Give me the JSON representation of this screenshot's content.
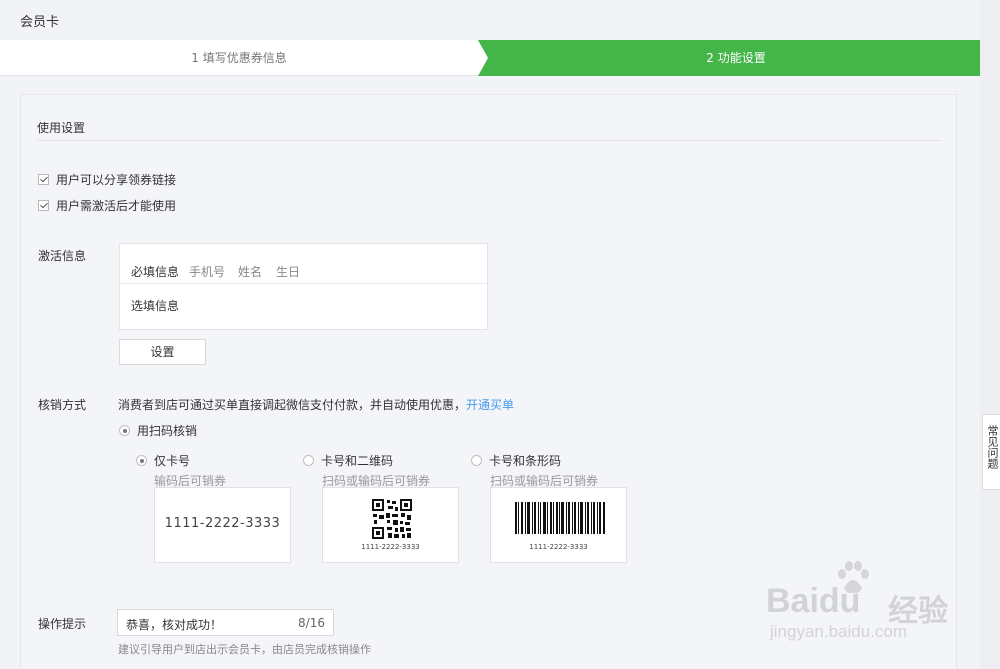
{
  "header": {
    "title": "会员卡"
  },
  "steps": [
    {
      "label": "1 填写优惠券信息",
      "active": false
    },
    {
      "label": "2 功能设置",
      "active": true
    }
  ],
  "colors": {
    "accent": "#44b549",
    "link": "#459ae9"
  },
  "section": {
    "title": "使用设置"
  },
  "checkboxes": [
    {
      "label": "用户可以分享领券链接",
      "checked": true
    },
    {
      "label": "用户需激活后才能使用",
      "checked": true
    }
  ],
  "activation": {
    "label": "激活信息",
    "required_label": "必填信息",
    "required_items": [
      "手机号",
      "姓名",
      "生日"
    ],
    "optional_label": "选填信息",
    "setting_button": "设置"
  },
  "verify": {
    "label": "核销方式",
    "description": "消费者到店可通过买单直接调起微信支付付款，并自动使用优惠，",
    "link": "开通买单",
    "scan_option": "用扫码核销",
    "options": [
      {
        "label": "仅卡号",
        "hint": "输码后可销券",
        "selected": true,
        "code": "1111-2222-3333"
      },
      {
        "label": "卡号和二维码",
        "hint": "扫码或输码后可销券",
        "selected": false,
        "code": "1111-2222-3333"
      },
      {
        "label": "卡号和条形码",
        "hint": "扫码或输码后可销券",
        "selected": false,
        "code": "1111-2222-3333"
      }
    ]
  },
  "tip": {
    "label": "操作提示",
    "value": "恭喜，核对成功！",
    "count": "8/16",
    "hint": "建议引导用户到店出示会员卡，由店员完成核销操作"
  },
  "help_tab": {
    "label": "常见问题"
  },
  "watermark": {
    "logo": "Baidu",
    "suffix": "经验",
    "url": "jingyan.baidu.com"
  }
}
